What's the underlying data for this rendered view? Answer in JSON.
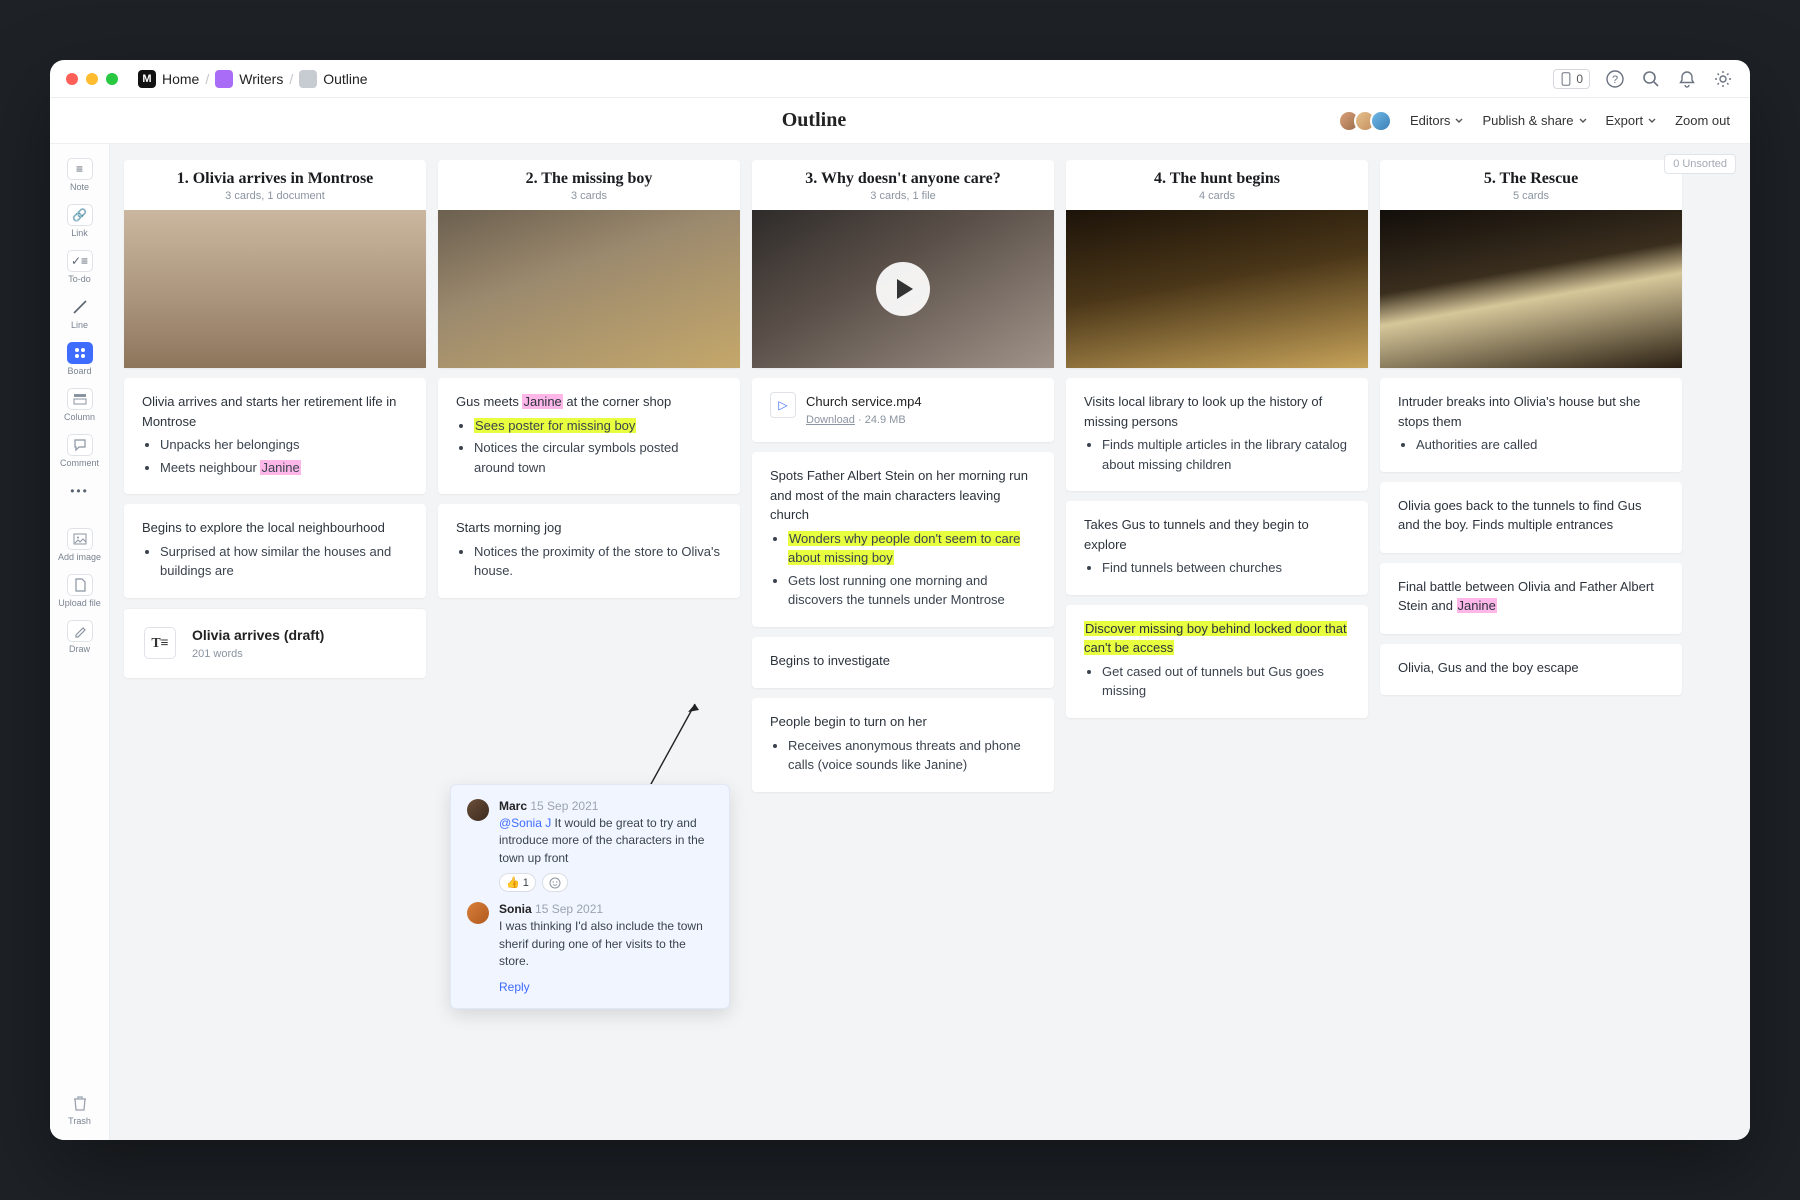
{
  "titlebar": {
    "home": "Home",
    "writers": "Writers",
    "outline": "Outline",
    "outline_pill": "0"
  },
  "header": {
    "title": "Outline",
    "editors": "Editors",
    "publish": "Publish & share",
    "export": "Export",
    "zoom": "Zoom out"
  },
  "sidebar": {
    "items": [
      {
        "label": "Note"
      },
      {
        "label": "Link"
      },
      {
        "label": "To-do"
      },
      {
        "label": "Line"
      },
      {
        "label": "Board"
      },
      {
        "label": "Column"
      },
      {
        "label": "Comment"
      },
      {
        "label": ""
      },
      {
        "label": "Add image"
      },
      {
        "label": "Upload file"
      },
      {
        "label": "Draw"
      },
      {
        "label": "Trash"
      }
    ]
  },
  "unsorted": "0 Unsorted",
  "columns": [
    {
      "title": "1. Olivia arrives in Montrose",
      "meta": "3 cards, 1 document",
      "cards": [
        {
          "text": "Olivia arrives and starts her retirement life in Montrose",
          "bullets": [
            "Unpacks her belongings",
            "Meets neighbour <pink>Janine</pink>"
          ]
        },
        {
          "text": "Begins to explore the local neighbourhood",
          "bullets": [
            "Surprised at how similar the houses and buildings are"
          ]
        }
      ],
      "doc": {
        "title": "Olivia arrives (draft)",
        "meta": "201 words"
      }
    },
    {
      "title": "2. The missing boy",
      "meta": "3 cards",
      "cards": [
        {
          "text": "Gus meets <pink>Janine</pink> at the corner shop",
          "bullets": [
            "<yellow>Sees poster for missing boy</yellow>",
            "Notices the circular symbols posted around town"
          ]
        },
        {
          "text": "Starts morning jog",
          "bullets": [
            "Notices the proximity of the store to Oliva's house."
          ]
        }
      ]
    },
    {
      "title": "3. Why doesn't anyone care?",
      "meta": "3 cards, 1 file",
      "file": {
        "name": "Church service.mp4",
        "meta": "Download",
        "size": " · 24.9 MB"
      },
      "video": true,
      "cards": [
        {
          "text": "Spots Father Albert Stein on her morning run and most of the main characters leaving church",
          "bullets": [
            "<yellow>Wonders why people don't seem to care about missing boy</yellow>",
            "Gets lost running one morning and discovers the tunnels under Montrose"
          ]
        },
        {
          "text": "Begins to investigate"
        },
        {
          "text": "People begin to turn on her",
          "bullets": [
            "Receives anonymous threats and phone calls (voice sounds like Janine)"
          ]
        }
      ]
    },
    {
      "title": "4. The hunt begins",
      "meta": "4 cards",
      "cards": [
        {
          "text": "Visits local library to look up the history of missing persons",
          "bullets": [
            "Finds multiple articles in the library catalog about missing children"
          ]
        },
        {
          "text": "Takes Gus to tunnels and they begin to explore",
          "bullets": [
            "Find tunnels between churches"
          ]
        },
        {
          "text": "<yellow>Discover missing boy behind locked door that can't be access</yellow>",
          "bullets": [
            "Get cased out of tunnels but Gus goes missing"
          ]
        }
      ]
    },
    {
      "title": "5. The Rescue",
      "meta": "5 cards",
      "cards": [
        {
          "text": "Intruder breaks into Olivia's house but she stops them",
          "bullets": [
            "Authorities are called"
          ]
        },
        {
          "text": "Olivia goes back to the tunnels to find Gus and the boy. Finds multiple entrances"
        },
        {
          "text": "Final battle between Olivia and Father Albert Stein and <pink>Janine</pink>"
        },
        {
          "text": "Olivia, Gus and the boy escape"
        }
      ]
    }
  ],
  "comments": [
    {
      "author": "Marc",
      "date": "15 Sep 2021",
      "body": "<mention>@Sonia J</mention> It would be great to try and introduce more of the characters in the town up front",
      "react": "👍 1"
    },
    {
      "author": "Sonia",
      "date": "15 Sep 2021",
      "body": "I was thinking I'd also include the town sherif during one of her visits to the store."
    }
  ],
  "reply": "Reply"
}
